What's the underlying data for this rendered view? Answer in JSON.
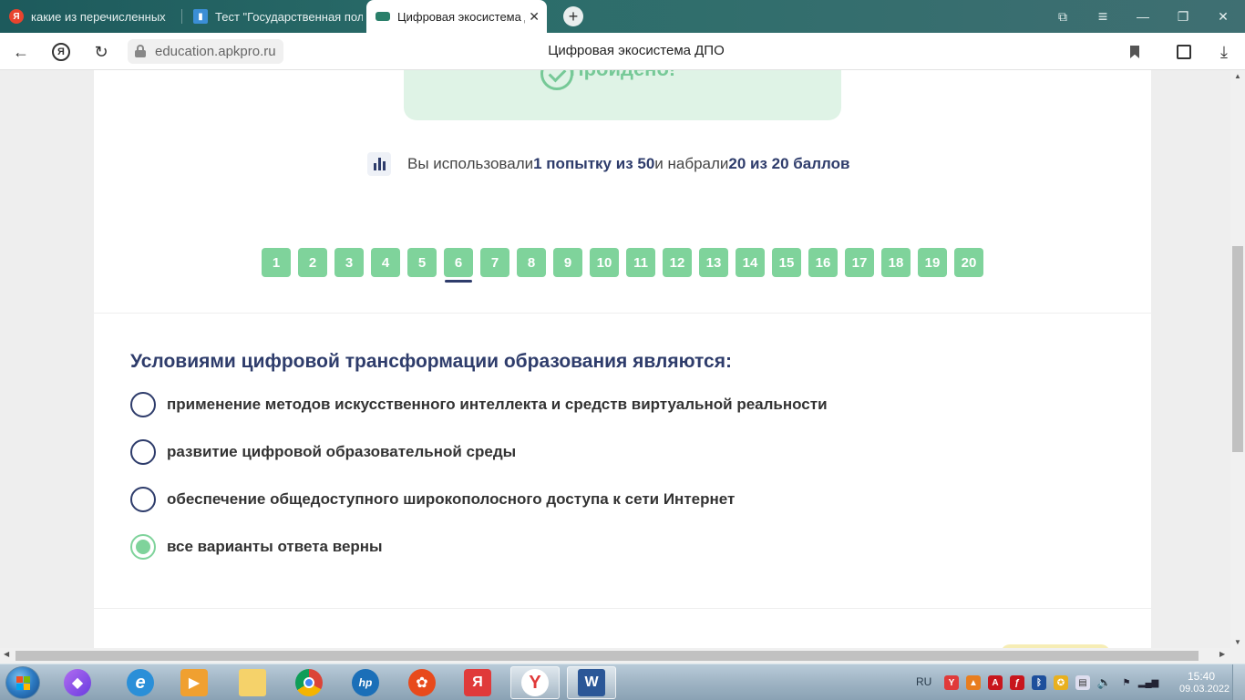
{
  "browser": {
    "tabs": [
      {
        "label": "какие из перечисленных",
        "favicon": "yandex-icon",
        "active": false
      },
      {
        "label": "Тест \"Государственная пол",
        "favicon": "book-icon",
        "active": false
      },
      {
        "label": "Цифровая экосистема Д",
        "favicon": "apkpro-icon",
        "active": true
      }
    ],
    "new_tab": "+",
    "url": "education.apkpro.ru",
    "page_title": "Цифровая экосистема ДПО",
    "window_controls": {
      "minimize": "—",
      "restore": "❐",
      "close": "✕",
      "menu": "≡",
      "collections": "⧉"
    }
  },
  "result": {
    "status": "Пройдено!",
    "stats_prefix": "Вы использовали ",
    "attempts": "1 попытку из 50",
    "stats_middle": " и набрали ",
    "score": "20 из 20 баллов"
  },
  "question_nav": {
    "numbers": [
      "1",
      "2",
      "3",
      "4",
      "5",
      "6",
      "7",
      "8",
      "9",
      "10",
      "11",
      "12",
      "13",
      "14",
      "15",
      "16",
      "17",
      "18",
      "19",
      "20"
    ],
    "current_index": 5
  },
  "question": {
    "text": "Условиями цифровой трансформации образования являются:",
    "options": [
      {
        "label": "применение методов искусственного интеллекта и средств виртуальной реальности",
        "checked": false
      },
      {
        "label": "развитие цифровой образовательной среды",
        "checked": false
      },
      {
        "label": "обеспечение общедоступного широкополосного доступа к сети Интернет",
        "checked": false
      },
      {
        "label": "все варианты ответа верны",
        "checked": true
      }
    ]
  },
  "taskbar": {
    "lang": "RU",
    "time": "15:40",
    "date": "09.03.2022"
  },
  "colors": {
    "accent_green": "#7fd39b",
    "navy": "#2e3c6b",
    "pass_bg": "#dff3e6"
  }
}
